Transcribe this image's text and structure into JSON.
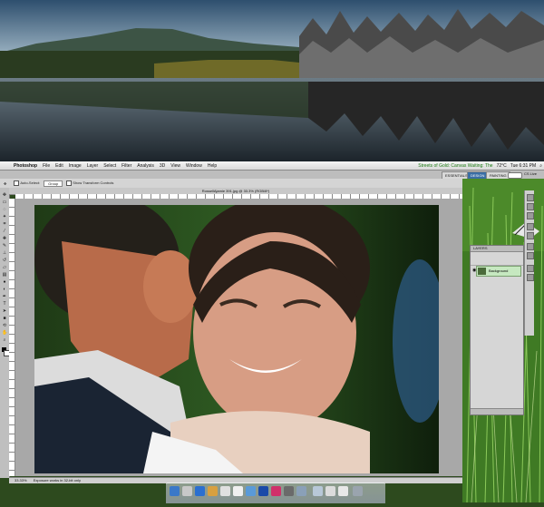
{
  "menubar": {
    "apple_glyph": "",
    "app_name": "Photoshop",
    "items": [
      "File",
      "Edit",
      "Image",
      "Layer",
      "Select",
      "Filter",
      "Analysis",
      "3D",
      "View",
      "Window",
      "Help"
    ],
    "status_text": "Streets of Gold: Canvas Waiting: The",
    "temperature": "72°C",
    "time": "Tue 6:31 PM"
  },
  "workspace": {
    "essentials": "ESSENTIALS",
    "design": "DESIGN",
    "painting": "PAINTING",
    "cs_live": "CS Live"
  },
  "options_bar": {
    "auto_select_label": "Auto-Select:",
    "auto_select_value": "Group",
    "show_transform_label": "Show Transform Controls"
  },
  "document": {
    "tab_title": "RossellAjamie 391.jpg @ 33.3% (RGB/8*)",
    "zoom": "33.33%",
    "status_text": "Exposure works in 32-bit only"
  },
  "layers_panel": {
    "title": "LAYERS",
    "layer_name": "Background"
  },
  "icons": {
    "eye": "eye-icon",
    "lock": "lock-icon",
    "move": "move-tool-icon"
  },
  "colors": {
    "accent": "#3a6ea5",
    "layer_selected": "#c6e8c0",
    "menubar": "#e6e6e6"
  }
}
